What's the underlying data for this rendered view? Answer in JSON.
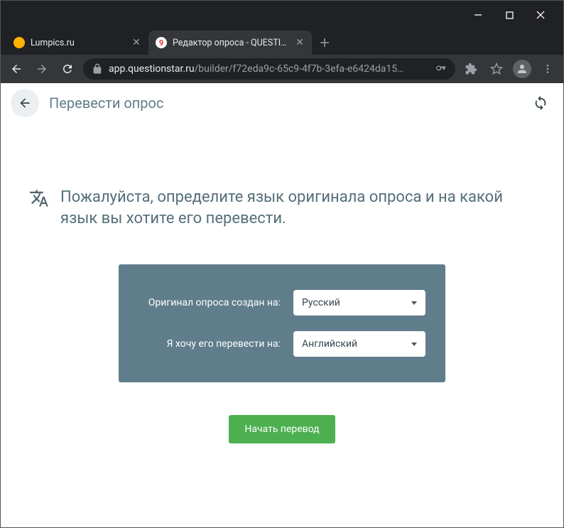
{
  "browser": {
    "tabs": [
      {
        "title": "Lumpics.ru",
        "favicon_color": "#ffb300",
        "active": false
      },
      {
        "title": "Редактор опроса - QUESTIONST",
        "favicon_color": "#ffffff",
        "active": true
      }
    ],
    "url_host": "app.questionstar.ru",
    "url_path": "/builder/f72eda9c-65c9-4f7b-3efa-e6424da15…"
  },
  "app": {
    "toolbar_title": "Перевести опрос",
    "heading": "Пожалуйста, определите язык оригинала опроса и на какой язык вы хотите его перевести.",
    "fields": {
      "original_label": "Оригинал опроса создан на:",
      "original_value": "Русский",
      "target_label": "Я хочу его перевести на:",
      "target_value": "Английский"
    },
    "start_button": "Начать перевод"
  }
}
